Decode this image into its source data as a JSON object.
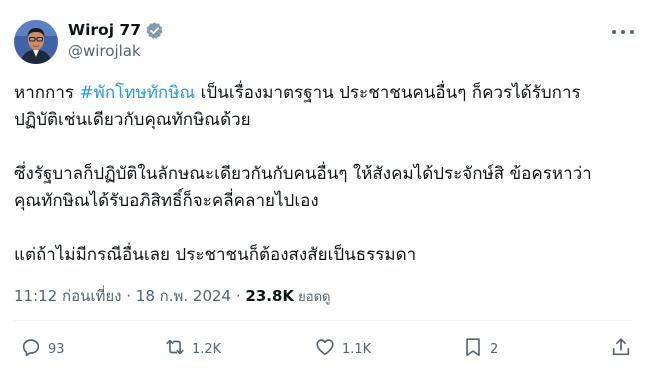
{
  "user": {
    "display_name": "Wiroj 77",
    "handle": "@wirojlak",
    "verified": true
  },
  "tweet": {
    "line1_prefix": "หากการ ",
    "hashtag": "#พักโทษทักษิณ",
    "line1_suffix": " เป็นเรื่องมาตรฐาน ประชาชนคนอื่นๆ ก็ควรได้รับการ",
    "line2": "ปฏิบัติเช่นเดียวกับคุณทักษิณด้วย",
    "line3": "ซึ่งรัฐบาลก็ปฏิบัติในลักษณะเดียวกันกับคนอื่นๆ ให้สังคมได้ประจักษ์สิ ข้อครหาว่า",
    "line4": "คุณทักษิณได้รับอภิสิทธิ์ก็จะคลี่คลายไปเอง",
    "line5": "แต่ถ้าไม่มีกรณีอื่นเลย ประชาชนก็ต้องสงสัยเป็นธรรมดา"
  },
  "meta": {
    "time": "11:12 ก่อนเที่ยง",
    "separator": " · ",
    "date": "18 ก.พ. 2024",
    "views_count": "23.8K",
    "views_label": " ยอดดู"
  },
  "actions": {
    "replies": "93",
    "reposts": "1.2K",
    "likes": "1.1K",
    "bookmarks": "2"
  },
  "colors": {
    "hashtag": "#1d9bf0",
    "verified": "#829aab",
    "secondary_text": "#536471"
  },
  "icons": [
    "verified-badge-icon",
    "more-icon",
    "reply-icon",
    "repost-icon",
    "like-icon",
    "bookmark-icon",
    "share-icon"
  ]
}
